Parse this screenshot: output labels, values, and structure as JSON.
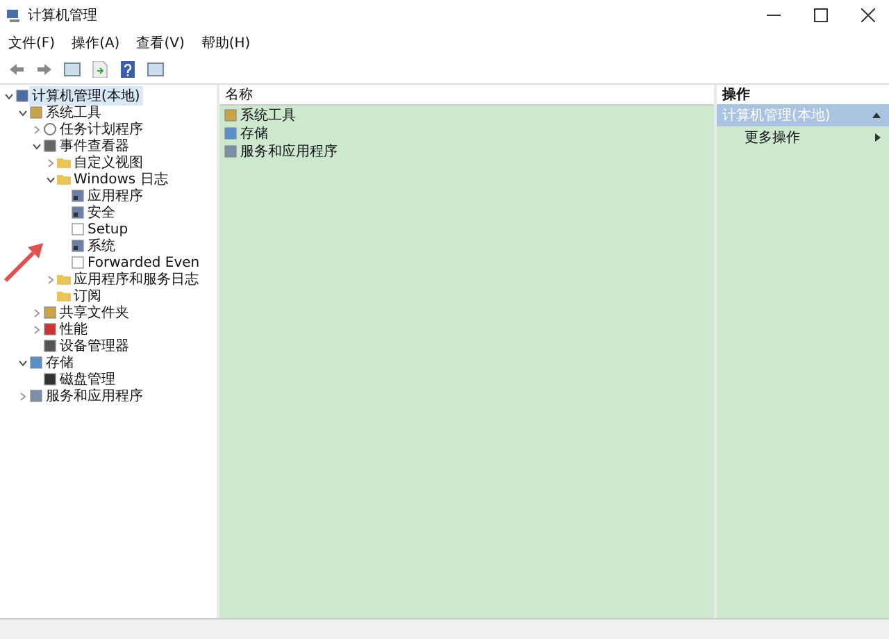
{
  "window": {
    "title": "计算机管理"
  },
  "menu": [
    "文件(F)",
    "操作(A)",
    "查看(V)",
    "帮助(H)"
  ],
  "tree": {
    "label": "计算机管理(本地)",
    "kind": "computer",
    "selected": true,
    "expanded": true,
    "children": [
      {
        "label": "系统工具",
        "kind": "tools",
        "expanded": true,
        "selected": false,
        "children": [
          {
            "label": "任务计划程序",
            "kind": "clock",
            "expanded": false,
            "selected": false
          },
          {
            "label": "事件查看器",
            "kind": "viewer",
            "expanded": true,
            "selected": false,
            "children": [
              {
                "label": "自定义视图",
                "kind": "folder",
                "expanded": false,
                "selected": false
              },
              {
                "label": "Windows 日志",
                "kind": "folder",
                "expanded": true,
                "selected": false,
                "children": [
                  {
                    "label": "应用程序",
                    "kind": "log",
                    "selected": false
                  },
                  {
                    "label": "安全",
                    "kind": "log",
                    "selected": false
                  },
                  {
                    "label": "Setup",
                    "kind": "blank",
                    "selected": false
                  },
                  {
                    "label": "系统",
                    "kind": "log",
                    "selected": false
                  },
                  {
                    "label": "Forwarded Even",
                    "kind": "blank",
                    "selected": false
                  }
                ]
              },
              {
                "label": "应用程序和服务日志",
                "kind": "folder",
                "expanded": false,
                "selected": false
              },
              {
                "label": "订阅",
                "kind": "folder",
                "selected": false
              }
            ]
          },
          {
            "label": "共享文件夹",
            "kind": "share",
            "expanded": false,
            "selected": false
          },
          {
            "label": "性能",
            "kind": "perf",
            "expanded": false,
            "selected": false
          },
          {
            "label": "设备管理器",
            "kind": "device",
            "selected": false
          }
        ]
      },
      {
        "label": "存储",
        "kind": "storage",
        "expanded": true,
        "selected": false,
        "children": [
          {
            "label": "磁盘管理",
            "kind": "disk",
            "selected": false
          }
        ]
      },
      {
        "label": "服务和应用程序",
        "kind": "services",
        "expanded": false,
        "selected": false
      }
    ]
  },
  "list": {
    "column": "名称",
    "items": [
      {
        "label": "系统工具",
        "kind": "tools"
      },
      {
        "label": "存储",
        "kind": "storage"
      },
      {
        "label": "服务和应用程序",
        "kind": "services"
      }
    ]
  },
  "actions": {
    "header": "操作",
    "section": "计算机管理(本地)",
    "items": [
      "更多操作"
    ]
  }
}
